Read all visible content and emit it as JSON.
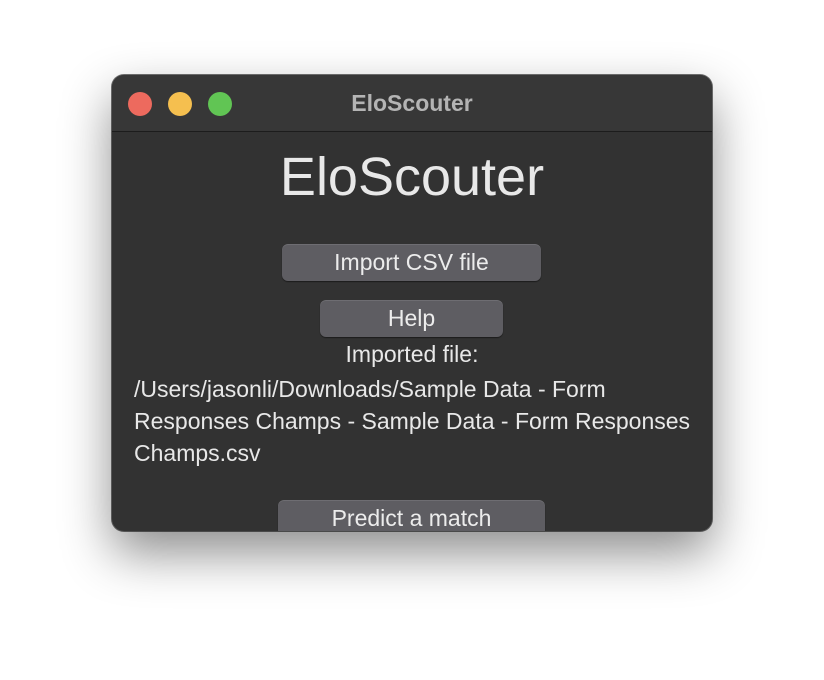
{
  "window": {
    "title": "EloScouter"
  },
  "main": {
    "heading": "EloScouter",
    "import_button_label": "Import CSV file",
    "help_button_label": "Help",
    "imported_file_label": "Imported file:",
    "imported_file_path": "/Users/jasonli/Downloads/Sample Data - Form Responses Champs - Sample Data - Form Responses Champs.csv",
    "predict_button_label": "Predict a match"
  },
  "colors": {
    "window_background": "#323232",
    "button_background": "#5e5d62",
    "close": "#ed6a5e",
    "minimize": "#f5bf4f",
    "zoom": "#61c554"
  }
}
